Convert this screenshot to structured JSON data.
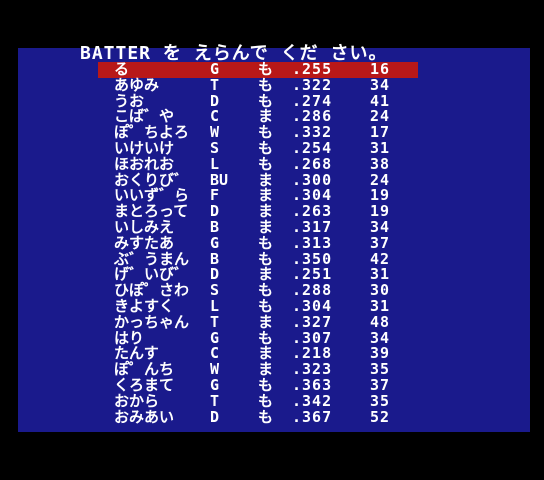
{
  "header": {
    "title": "BATTER を えらんで くだ さい。"
  },
  "colors": {
    "background": "#000000",
    "screen": "#1a1a8c",
    "highlight": "#b81818",
    "text": "#ffffff"
  },
  "players": [
    {
      "name": "る",
      "pos": "G",
      "hand": "も",
      "avg": ".255",
      "hr": "16"
    },
    {
      "name": "あゆみ",
      "pos": "T",
      "hand": "も",
      "avg": ".322",
      "hr": "34"
    },
    {
      "name": "うお",
      "pos": "D",
      "hand": "も",
      "avg": ".274",
      "hr": "41"
    },
    {
      "name": "こば゛や",
      "pos": "C",
      "hand": "ま",
      "avg": ".286",
      "hr": "24"
    },
    {
      "name": "ぽ゜ちよろ",
      "pos": "W",
      "hand": "も",
      "avg": ".332",
      "hr": "17"
    },
    {
      "name": "いけいけ",
      "pos": "S",
      "hand": "も",
      "avg": ".254",
      "hr": "31"
    },
    {
      "name": "ほおれお",
      "pos": "L",
      "hand": "も",
      "avg": ".268",
      "hr": "38"
    },
    {
      "name": "おくりび゛",
      "pos": "BU",
      "hand": "ま",
      "avg": ".300",
      "hr": "24"
    },
    {
      "name": "いいず゛ら",
      "pos": "F",
      "hand": "ま",
      "avg": ".304",
      "hr": "19"
    },
    {
      "name": "まとろって",
      "pos": "D",
      "hand": "ま",
      "avg": ".263",
      "hr": "19"
    },
    {
      "name": "いしみえ",
      "pos": "B",
      "hand": "ま",
      "avg": ".317",
      "hr": "34"
    },
    {
      "name": "みすたあ",
      "pos": "G",
      "hand": "も",
      "avg": ".313",
      "hr": "37"
    },
    {
      "name": "ぶ゛うまん",
      "pos": "B",
      "hand": "も",
      "avg": ".350",
      "hr": "42"
    },
    {
      "name": "げ゛いび゛",
      "pos": "D",
      "hand": "ま",
      "avg": ".251",
      "hr": "31"
    },
    {
      "name": "ひぽ゜さわ",
      "pos": "S",
      "hand": "も",
      "avg": ".288",
      "hr": "30"
    },
    {
      "name": "きよすく",
      "pos": "L",
      "hand": "も",
      "avg": ".304",
      "hr": "31"
    },
    {
      "name": "かっちゃん",
      "pos": "T",
      "hand": "ま",
      "avg": ".327",
      "hr": "48"
    },
    {
      "name": "はり",
      "pos": "G",
      "hand": "も",
      "avg": ".307",
      "hr": "34"
    },
    {
      "name": "たんす",
      "pos": "C",
      "hand": "ま",
      "avg": ".218",
      "hr": "39"
    },
    {
      "name": "ぽ゜んち",
      "pos": "W",
      "hand": "ま",
      "avg": ".323",
      "hr": "35"
    },
    {
      "name": "くろまて",
      "pos": "G",
      "hand": "も",
      "avg": ".363",
      "hr": "37"
    },
    {
      "name": "おから",
      "pos": "T",
      "hand": "も",
      "avg": ".342",
      "hr": "35"
    },
    {
      "name": "おみあい",
      "pos": "D",
      "hand": "も",
      "avg": ".367",
      "hr": "52"
    }
  ]
}
